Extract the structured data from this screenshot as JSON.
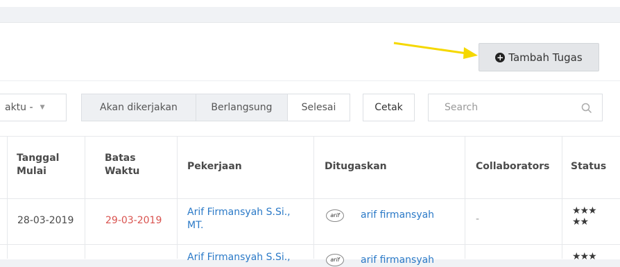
{
  "toolbar": {
    "add_task_label": "Tambah Tugas",
    "filter_select_value": "aktu -",
    "segments": [
      "Akan dikerjakan",
      "Berlangsung",
      "Selesai"
    ],
    "print_label": "Cetak",
    "search_placeholder": "Search"
  },
  "table": {
    "headers": {
      "start_date": [
        "Tanggal",
        "Mulai"
      ],
      "deadline": [
        "Batas",
        "Waktu"
      ],
      "job": "Pekerjaan",
      "assigned": "Ditugaskan",
      "collaborators": "Collaborators",
      "status": "Status"
    },
    "rows": [
      {
        "start_date": "28-03-2019",
        "deadline": "29-03-2019",
        "job_line1": "Arif Firmansyah S.Si.,",
        "job_line2": "MT.",
        "assignee": "arif firmansyah",
        "avatar_text": "arif",
        "collaborators": "-",
        "stars_line1": "★★★",
        "stars_line2": "★★"
      },
      {
        "job_line1": "Arif Firmansyah S.Si.,",
        "assignee": "arif firmansyah",
        "avatar_text": "arif",
        "stars_line1": "★★★"
      }
    ]
  }
}
